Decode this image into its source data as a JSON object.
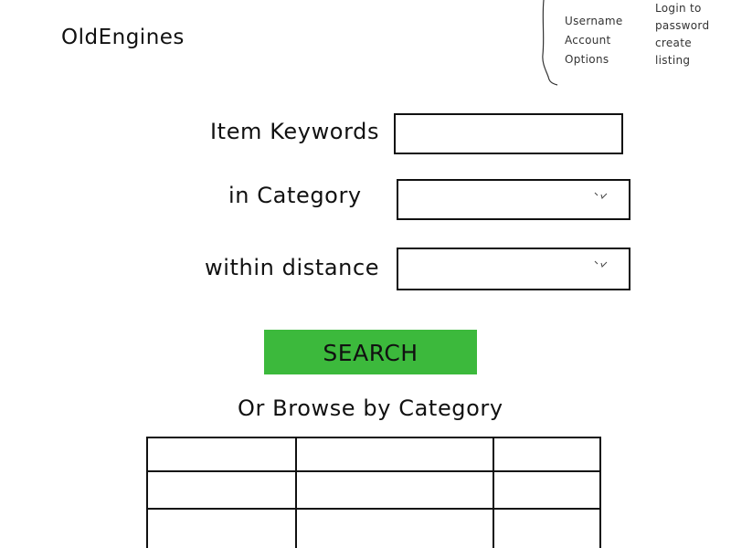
{
  "header": {
    "logo_text": "OldEngines"
  },
  "account_menu": {
    "left_items": [
      "Username",
      "Account",
      "Options"
    ],
    "right_items": [
      "Login to",
      "password",
      "create",
      "listing"
    ]
  },
  "search_form": {
    "keywords_label": "Item Keywords",
    "keywords_value": "",
    "category_label": "in Category",
    "category_value": "",
    "distance_label": "within distance",
    "distance_value": "",
    "search_button_label": "SEARCH",
    "button_color": "#3cb93c"
  },
  "browse": {
    "heading": "Or Browse by Category",
    "rows": [
      [
        "",
        "",
        ""
      ],
      [
        "",
        "",
        ""
      ],
      [
        "",
        "",
        ""
      ]
    ]
  },
  "icons": {
    "select_arrow": "chevron-down-icon",
    "account_bracket": "bracket-icon"
  }
}
